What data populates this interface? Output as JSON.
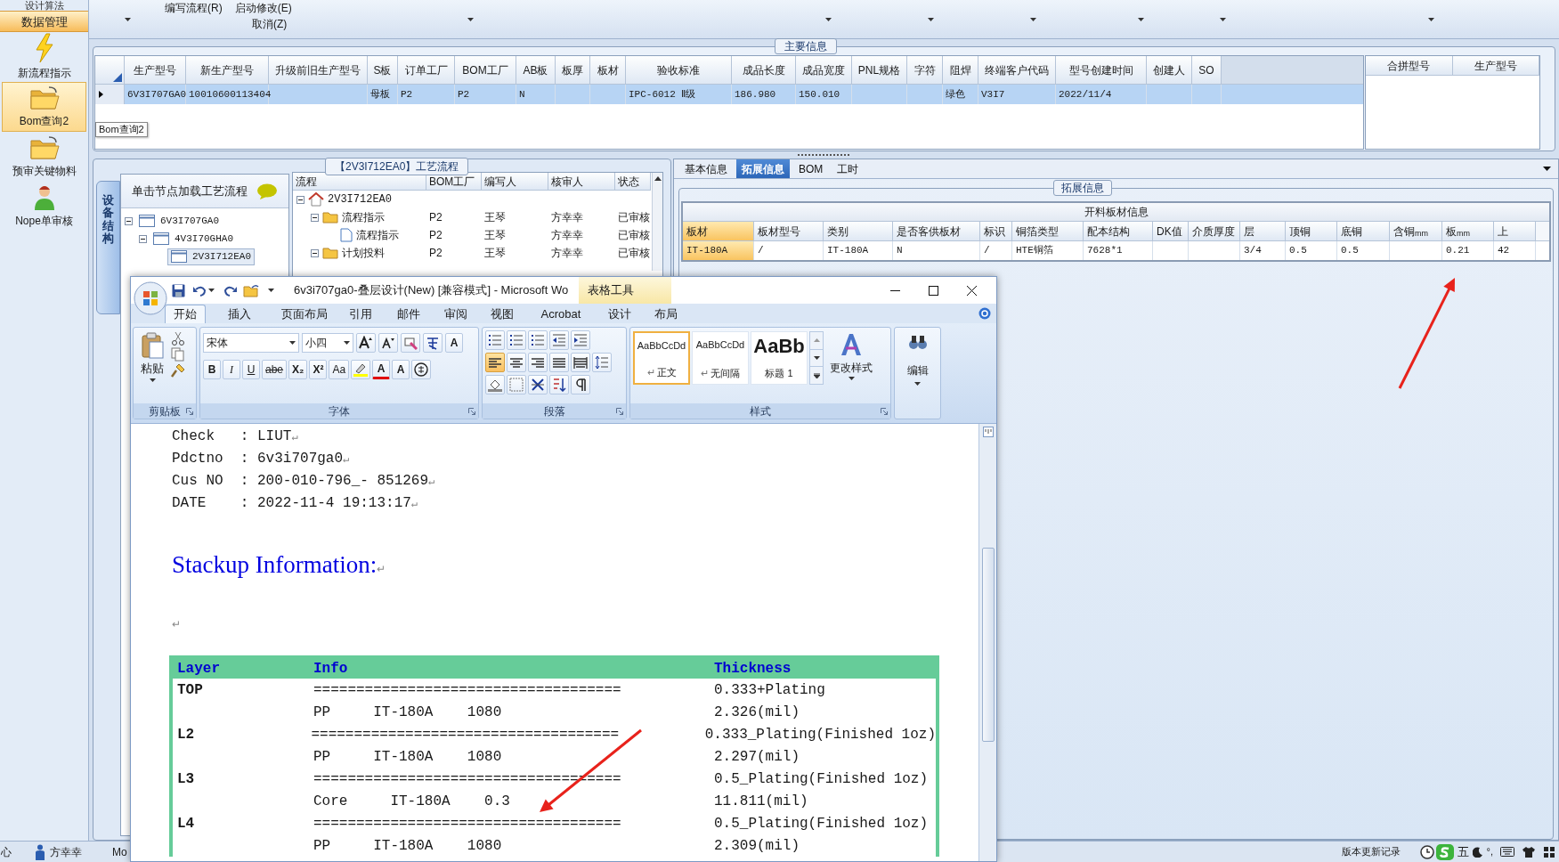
{
  "sidebar": {
    "partial_item": "设计算法",
    "group": "数据管理",
    "items": [
      {
        "label": "新流程指示",
        "kind": "lightning",
        "selected": false
      },
      {
        "label": "Bom查询2",
        "kind": "folder",
        "selected": true
      },
      {
        "label": "预审关键物料",
        "kind": "folder",
        "selected": false
      },
      {
        "label": "Nope单审核",
        "kind": "person",
        "selected": false
      }
    ]
  },
  "toolbar": {
    "items": [
      "编写流程(R)",
      "启动修改(E)",
      "取消(Z)"
    ]
  },
  "main_info": {
    "title": "主要信息",
    "columns": [
      "生产型号",
      "新生产型号",
      "升级前旧生产型号",
      "S板",
      "订单工厂",
      "BOM工厂",
      "AB板",
      "板厚",
      "板材",
      "验收标准",
      "成品长度",
      "成品宽度",
      "PNL规格",
      "字符",
      "阻焊",
      "终端客户代码",
      "型号创建时间",
      "创建人",
      "SO"
    ],
    "rows": [
      {
        "selected": true,
        "cells": [
          "6V3I707GA0",
          "10010600113404",
          null,
          "母板",
          "P2",
          "P2",
          "N",
          null,
          null,
          "IPC-6012 Ⅱ级",
          "186.980",
          "150.010",
          null,
          null,
          "绿色",
          "V3I7",
          "2022/11/4",
          null,
          null
        ]
      }
    ],
    "tooltip": "Bom查询2",
    "side_columns": [
      "合拼型号",
      "生产型号"
    ]
  },
  "process": {
    "title": "【2V3I712EA0】工艺流程",
    "side_tab": "设备结构",
    "hint": "单击节点加载工艺流程",
    "tree": [
      {
        "label": "6V3I707GA0",
        "selected": false,
        "expanded": true,
        "children": [
          {
            "label": "4V3I70GHA0",
            "selected": false,
            "expanded": true,
            "children": [
              {
                "label": "2V3I712EA0",
                "selected": true
              }
            ]
          }
        ]
      }
    ],
    "columns": [
      "流程",
      "BOM工厂",
      "编写人",
      "核审人",
      "状态"
    ],
    "rows": [
      {
        "name": "2V3I712EA0",
        "kind": "home",
        "expanded": true,
        "children": [
          {
            "name": "流程指示",
            "kind": "folder",
            "expanded": true,
            "cells": [
              "P2",
              "王琴",
              "方幸幸",
              "已审核"
            ],
            "children": [
              {
                "name": "流程指示",
                "kind": "document",
                "cells": [
                  "P2",
                  "王琴",
                  "方幸幸",
                  "已审核"
                ]
              }
            ]
          },
          {
            "name": "计划投料",
            "kind": "folder",
            "expanded": true,
            "cells": [
              "P2",
              "王琴",
              "方幸幸",
              "已审核"
            ]
          }
        ]
      }
    ]
  },
  "detail": {
    "tabs": [
      {
        "label": "基本信息",
        "selected": false
      },
      {
        "label": "拓展信息",
        "selected": true
      },
      {
        "label": "BOM",
        "selected": false
      },
      {
        "label": "工时",
        "selected": false
      }
    ],
    "group": "拓展信息",
    "grid_title": "开料板材信息",
    "columns": [
      {
        "label": "板材",
        "selected": true
      },
      {
        "label": "板材型号",
        "selected": false
      },
      {
        "label": "类别",
        "selected": false
      },
      {
        "label": "是否客供板材",
        "selected": false
      },
      {
        "label": "标识",
        "selected": false
      },
      {
        "label": "铜箔类型",
        "selected": false
      },
      {
        "label": "配本结构",
        "selected": false
      },
      {
        "label": "DK值",
        "selected": false
      },
      {
        "label": "介质厚度",
        "selected": false
      },
      {
        "label": "层",
        "selected": false
      },
      {
        "label": "顶铜",
        "selected": false
      },
      {
        "label": "底铜",
        "selected": false
      },
      {
        "label": "含铜$_{mm}$",
        "selected": false
      },
      {
        "label": "板$_{mm}$",
        "selected": false
      },
      {
        "label": "上",
        "selected": false
      }
    ],
    "rows": [
      [
        "IT-180A",
        "/",
        "IT-180A",
        "N",
        "/",
        "HTE铜箔",
        "7628*1",
        null,
        null,
        "3/4",
        "0.5",
        "0.5",
        null,
        "0.21",
        "42"
      ]
    ]
  },
  "word": {
    "title": "6v3i707ga0-叠层设计(New) [兼容模式] - Microsoft Wo",
    "context_tab": "表格工具",
    "tabs": [
      {
        "label": "开始",
        "selected": true
      },
      {
        "label": "插入",
        "selected": false
      },
      {
        "label": "页面布局",
        "selected": false
      },
      {
        "label": "引用",
        "selected": false
      },
      {
        "label": "邮件",
        "selected": false
      },
      {
        "label": "审阅",
        "selected": false
      },
      {
        "label": "视图",
        "selected": false
      },
      {
        "label": "Acrobat",
        "selected": false
      },
      {
        "label": "设计",
        "selected": false
      },
      {
        "label": "布局",
        "selected": false
      }
    ],
    "clipboard": {
      "label": "剪贴板",
      "paste": "粘贴"
    },
    "font": {
      "label": "字体",
      "name": "宋体",
      "size": "小四",
      "border_char": "A",
      "buttons": [
        "B",
        "I",
        "U",
        "abe",
        "X₂",
        "X²",
        "Aa"
      ],
      "color_char": "A",
      "shade_char": "A"
    },
    "paragraph": {
      "label": "段落",
      "alignments": [
        {
          "kind": "left",
          "selected": true
        },
        {
          "kind": "center",
          "selected": false
        },
        {
          "kind": "right",
          "selected": false
        },
        {
          "kind": "justify",
          "selected": false
        },
        {
          "kind": "distributed",
          "selected": false
        }
      ]
    },
    "styles": {
      "label": "样式",
      "items": [
        {
          "sample": "AaBbCcDd",
          "name": "正文",
          "mark": "↵",
          "kind": "normal",
          "selected": true
        },
        {
          "sample": "AaBbCcDd",
          "name": "无间隔",
          "mark": "↵",
          "kind": "normal",
          "selected": false
        },
        {
          "sample": "AaBb",
          "name": "标题 1",
          "kind": "heading",
          "selected": false
        }
      ],
      "change": "更改样式"
    },
    "editing": {
      "label": "编辑"
    },
    "document": {
      "lines": [
        {
          "text": "Check   : LIUT",
          "mark": "↵"
        },
        {
          "text": "Pdctno  : 6v3i707ga0",
          "mark": "↵"
        },
        {
          "text": "Cus NO  : 200-010-796_- 851269",
          "mark": "↵"
        },
        {
          "text": "DATE    : 2022-11-4 19:13:17",
          "mark": "↵"
        }
      ],
      "heading": {
        "text": "Stackup Information:",
        "mark": "↵"
      },
      "blank": {
        "mark": "↵"
      },
      "table": {
        "columns": [
          "Layer",
          "Info",
          "Thickness"
        ],
        "rows": [
          {
            "layer": "TOP",
            "info": "====================================",
            "thickness": "0.333+Plating"
          },
          {
            "info": "PP     IT-180A    1080",
            "thickness": "2.326(mil)"
          },
          {
            "layer": "L2",
            "info": "====================================",
            "thickness": "0.333_Plating(Finished 1oz)"
          },
          {
            "info": "PP     IT-180A    1080",
            "thickness": "2.297(mil)"
          },
          {
            "layer": "L3",
            "info": "====================================",
            "thickness": "0.5_Plating(Finished 1oz)"
          },
          {
            "info": "Core     IT-180A    0.3",
            "thickness": "11.811(mil)"
          },
          {
            "layer": "L4",
            "info": "====================================",
            "thickness": "0.5_Plating(Finished 1oz)"
          },
          {
            "info": "PP     IT-180A    1080",
            "thickness": "2.309(mil)"
          }
        ]
      }
    }
  },
  "status_bar": {
    "left_text": "心",
    "user": "方幸幸",
    "cut_text": "Mo",
    "link": "版本更新记录",
    "tray_mode": "五",
    "tray_punct": "°,"
  }
}
